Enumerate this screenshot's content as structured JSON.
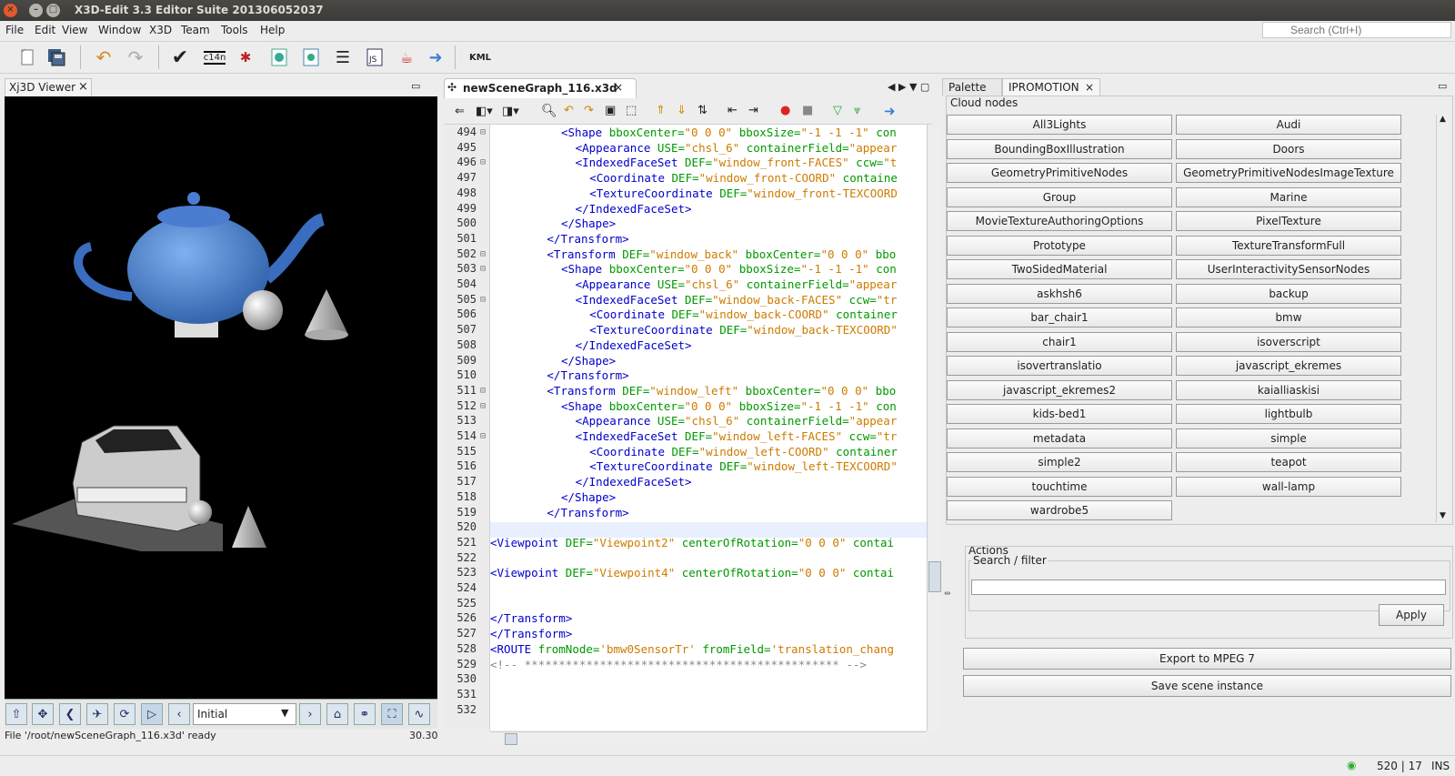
{
  "window": {
    "title": "X3D-Edit 3.3 Editor Suite 201306052037"
  },
  "menu": [
    "File",
    "Edit",
    "View",
    "Window",
    "X3D",
    "Team",
    "Tools",
    "Help"
  ],
  "search": {
    "placeholder": "Search (Ctrl+I)"
  },
  "toolbar": {
    "c14n_label": "c14n",
    "kml_label": "KML"
  },
  "viewer": {
    "tab_label": "Xj3D Viewer",
    "viewpoint_selected": "Initial",
    "status_text": "File '/root/newSceneGraph_116.x3d' ready",
    "fps": "30.30"
  },
  "editor": {
    "tab_label": "newSceneGraph_116.x3d",
    "lines": [
      {
        "n": "494",
        "fold": "⊟",
        "i": 5,
        "html": "<span class='tg'>&lt;Shape</span> <span class='at'>bboxCenter=</span><span class='vl'>\"0 0 0\"</span> <span class='at'>bboxSize=</span><span class='vl'>\"-1 -1 -1\"</span> <span class='at'>con</span>"
      },
      {
        "n": "495",
        "fold": "",
        "i": 6,
        "html": "<span class='tg'>&lt;Appearance</span> <span class='at'>USE=</span><span class='vl'>\"chsl_6\"</span> <span class='at'>containerField=</span><span class='vl'>\"appear</span>"
      },
      {
        "n": "496",
        "fold": "⊟",
        "i": 6,
        "html": "<span class='tg'>&lt;IndexedFaceSet</span> <span class='at'>DEF=</span><span class='vl'>\"window_front-FACES\"</span> <span class='at'>ccw=</span><span class='vl'>\"t</span>"
      },
      {
        "n": "497",
        "fold": "",
        "i": 7,
        "html": "<span class='tg'>&lt;Coordinate</span> <span class='at'>DEF=</span><span class='vl'>\"window_front-COORD\"</span> <span class='at'>containe</span>"
      },
      {
        "n": "498",
        "fold": "",
        "i": 7,
        "html": "<span class='tg'>&lt;TextureCoordinate</span> <span class='at'>DEF=</span><span class='vl'>\"window_front-TEXCOORD</span>"
      },
      {
        "n": "499",
        "fold": "",
        "i": 6,
        "html": "<span class='tg'>&lt;/IndexedFaceSet&gt;</span>"
      },
      {
        "n": "500",
        "fold": "",
        "i": 5,
        "html": "<span class='tg'>&lt;/Shape&gt;</span>"
      },
      {
        "n": "501",
        "fold": "",
        "i": 4,
        "html": "<span class='tg'>&lt;/Transform&gt;</span>"
      },
      {
        "n": "502",
        "fold": "⊟",
        "i": 4,
        "html": "<span class='tg'>&lt;Transform</span> <span class='at'>DEF=</span><span class='vl'>\"window_back\"</span> <span class='at'>bboxCenter=</span><span class='vl'>\"0 0 0\"</span> <span class='at'>bbo</span>"
      },
      {
        "n": "503",
        "fold": "⊟",
        "i": 5,
        "html": "<span class='tg'>&lt;Shape</span> <span class='at'>bboxCenter=</span><span class='vl'>\"0 0 0\"</span> <span class='at'>bboxSize=</span><span class='vl'>\"-1 -1 -1\"</span> <span class='at'>con</span>"
      },
      {
        "n": "504",
        "fold": "",
        "i": 6,
        "html": "<span class='tg'>&lt;Appearance</span> <span class='at'>USE=</span><span class='vl'>\"chsl_6\"</span> <span class='at'>containerField=</span><span class='vl'>\"appear</span>"
      },
      {
        "n": "505",
        "fold": "⊟",
        "i": 6,
        "html": "<span class='tg'>&lt;IndexedFaceSet</span> <span class='at'>DEF=</span><span class='vl'>\"window_back-FACES\"</span> <span class='at'>ccw=</span><span class='vl'>\"tr</span>"
      },
      {
        "n": "506",
        "fold": "",
        "i": 7,
        "html": "<span class='tg'>&lt;Coordinate</span> <span class='at'>DEF=</span><span class='vl'>\"window_back-COORD\"</span> <span class='at'>container</span>"
      },
      {
        "n": "507",
        "fold": "",
        "i": 7,
        "html": "<span class='tg'>&lt;TextureCoordinate</span> <span class='at'>DEF=</span><span class='vl'>\"window_back-TEXCOORD\"</span>"
      },
      {
        "n": "508",
        "fold": "",
        "i": 6,
        "html": "<span class='tg'>&lt;/IndexedFaceSet&gt;</span>"
      },
      {
        "n": "509",
        "fold": "",
        "i": 5,
        "html": "<span class='tg'>&lt;/Shape&gt;</span>"
      },
      {
        "n": "510",
        "fold": "",
        "i": 4,
        "html": "<span class='tg'>&lt;/Transform&gt;</span>"
      },
      {
        "n": "511",
        "fold": "⊟",
        "i": 4,
        "html": "<span class='tg'>&lt;Transform</span> <span class='at'>DEF=</span><span class='vl'>\"window_left\"</span> <span class='at'>bboxCenter=</span><span class='vl'>\"0 0 0\"</span> <span class='at'>bbo</span>"
      },
      {
        "n": "512",
        "fold": "⊟",
        "i": 5,
        "html": "<span class='tg'>&lt;Shape</span> <span class='at'>bboxCenter=</span><span class='vl'>\"0 0 0\"</span> <span class='at'>bboxSize=</span><span class='vl'>\"-1 -1 -1\"</span> <span class='at'>con</span>"
      },
      {
        "n": "513",
        "fold": "",
        "i": 6,
        "html": "<span class='tg'>&lt;Appearance</span> <span class='at'>USE=</span><span class='vl'>\"chsl_6\"</span> <span class='at'>containerField=</span><span class='vl'>\"appear</span>"
      },
      {
        "n": "514",
        "fold": "⊟",
        "i": 6,
        "html": "<span class='tg'>&lt;IndexedFaceSet</span> <span class='at'>DEF=</span><span class='vl'>\"window_left-FACES\"</span> <span class='at'>ccw=</span><span class='vl'>\"tr</span>"
      },
      {
        "n": "515",
        "fold": "",
        "i": 7,
        "html": "<span class='tg'>&lt;Coordinate</span> <span class='at'>DEF=</span><span class='vl'>\"window_left-COORD\"</span> <span class='at'>container</span>"
      },
      {
        "n": "516",
        "fold": "",
        "i": 7,
        "html": "<span class='tg'>&lt;TextureCoordinate</span> <span class='at'>DEF=</span><span class='vl'>\"window_left-TEXCOORD\"</span>"
      },
      {
        "n": "517",
        "fold": "",
        "i": 6,
        "html": "<span class='tg'>&lt;/IndexedFaceSet&gt;</span>"
      },
      {
        "n": "518",
        "fold": "",
        "i": 5,
        "html": "<span class='tg'>&lt;/Shape&gt;</span>"
      },
      {
        "n": "519",
        "fold": "",
        "i": 4,
        "html": "<span class='tg'>&lt;/Transform&gt;</span>"
      },
      {
        "n": "520",
        "fold": "",
        "i": 0,
        "html": ""
      },
      {
        "n": "521",
        "fold": "",
        "i": 0,
        "html": "<span class='tg'>&lt;Viewpoint</span> <span class='at'>DEF=</span><span class='vl'>\"Viewpoint2\"</span> <span class='at'>centerOfRotation=</span><span class='vl'>\"0 0 0\"</span> <span class='at'>contai</span>"
      },
      {
        "n": "522",
        "fold": "",
        "i": 0,
        "html": ""
      },
      {
        "n": "523",
        "fold": "",
        "i": 0,
        "html": "<span class='tg'>&lt;Viewpoint</span> <span class='at'>DEF=</span><span class='vl'>\"Viewpoint4\"</span> <span class='at'>centerOfRotation=</span><span class='vl'>\"0 0 0\"</span> <span class='at'>contai</span>"
      },
      {
        "n": "524",
        "fold": "",
        "i": 0,
        "html": ""
      },
      {
        "n": "525",
        "fold": "",
        "i": 0,
        "html": ""
      },
      {
        "n": "526",
        "fold": "",
        "i": 0,
        "html": "<span class='tg'>&lt;/Transform&gt;</span>"
      },
      {
        "n": "527",
        "fold": "",
        "i": 0,
        "html": "<span class='tg'>&lt;/Transform&gt;</span>"
      },
      {
        "n": "528",
        "fold": "",
        "i": 0,
        "html": "<span class='tg'>&lt;ROUTE</span> <span class='at'>fromNode=</span><span class='vl'>'bmw0SensorTr'</span> <span class='at'>fromField=</span><span class='vl'>'translation_chang</span>"
      },
      {
        "n": "529",
        "fold": "",
        "i": 0,
        "html": "<span class='cm'>&lt;!-- ********************************************** --&gt;</span>"
      },
      {
        "n": "530",
        "fold": "",
        "i": 0,
        "html": ""
      },
      {
        "n": "531",
        "fold": "",
        "i": 0,
        "html": ""
      },
      {
        "n": "532",
        "fold": "",
        "i": 0,
        "html": ""
      }
    ]
  },
  "palette": {
    "tab_palette": "Palette",
    "tab_ipromotion": "IPROMOTION",
    "cloud_title": "Cloud nodes",
    "nodes": [
      "All3Lights",
      "Audi",
      "BoundingBoxIllustration",
      "Doors",
      "GeometryPrimitiveNodes",
      "GeometryPrimitiveNodesImageTexture",
      "Group",
      "Marine",
      "MovieTextureAuthoringOptions",
      "PixelTexture",
      "Prototype",
      "TextureTransformFull",
      "TwoSidedMaterial",
      "UserInteractivitySensorNodes",
      "askhsh6",
      "backup",
      "bar_chair1",
      "bmw",
      "chair1",
      "isoverscript",
      "isovertranslatio",
      "javascript_ekremes",
      "javascript_ekremes2",
      "kaialliaskisi",
      "kids-bed1",
      "lightbulb",
      "metadata",
      "simple",
      "simple2",
      "teapot",
      "touchtime",
      "wall-lamp",
      "wardrobe5"
    ],
    "actions_title": "Actions",
    "filter_title": "Search / filter",
    "filter_value": "",
    "apply_label": "Apply",
    "export_label": "Export to MPEG 7",
    "save_label": "Save scene instance"
  },
  "status": {
    "position": "520 | 17",
    "mode": "INS"
  }
}
